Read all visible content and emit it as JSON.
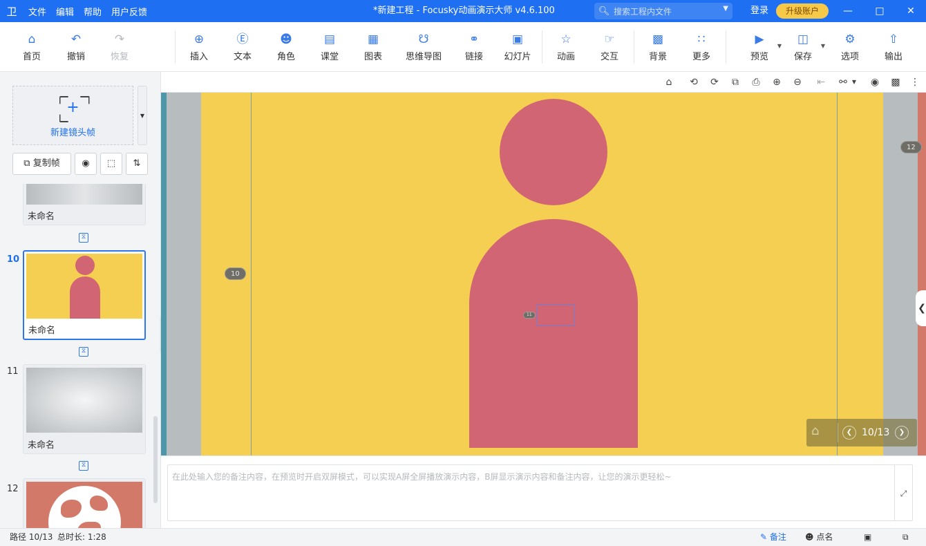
{
  "app": {
    "logo_glyph": "卫",
    "menu": [
      "文件",
      "编辑",
      "帮助",
      "用户反馈"
    ],
    "title": "*新建工程 - Focusky动画演示大师  v4.6.100",
    "search_placeholder": "搜索工程内文件",
    "login": "登录",
    "upgrade": "升级账户",
    "accent": "#1e6ff1"
  },
  "toolbar": {
    "home": "首页",
    "undo": "撤销",
    "redo": "恢复",
    "insert": "插入",
    "text": "文本",
    "role": "角色",
    "classroom": "课堂",
    "chart": "图表",
    "mindmap": "思维导图",
    "link": "链接",
    "slides": "幻灯片",
    "animation": "动画",
    "interaction": "交互",
    "background": "背景",
    "more": "更多",
    "preview": "预览",
    "save": "保存",
    "options": "选项",
    "export": "输出"
  },
  "sidebar": {
    "new_frame": "新建镜头帧",
    "copy_frame": "复制帧",
    "frames": [
      {
        "number": "",
        "name": "未命名"
      },
      {
        "number": "10",
        "name": "未命名",
        "active": true
      },
      {
        "number": "11",
        "name": "未命名"
      },
      {
        "number": "12",
        "name": ""
      }
    ]
  },
  "canvas": {
    "background_color": "#f5cf52",
    "figure_color": "#d26574",
    "badge_left": "10",
    "badge_right": "12",
    "badge_small": "11",
    "nav_counter": "10/13"
  },
  "notes": {
    "placeholder": "在此处输入您的备注内容，在预览时开启双屏模式，可以实现A屏全屏播放演示内容，B屏显示演示内容和备注内容，让您的演示更轻松~"
  },
  "status": {
    "path": "路径 10/13",
    "duration": "总时长: 1:28",
    "notes_label": "备注",
    "rollcall_label": "点名"
  }
}
